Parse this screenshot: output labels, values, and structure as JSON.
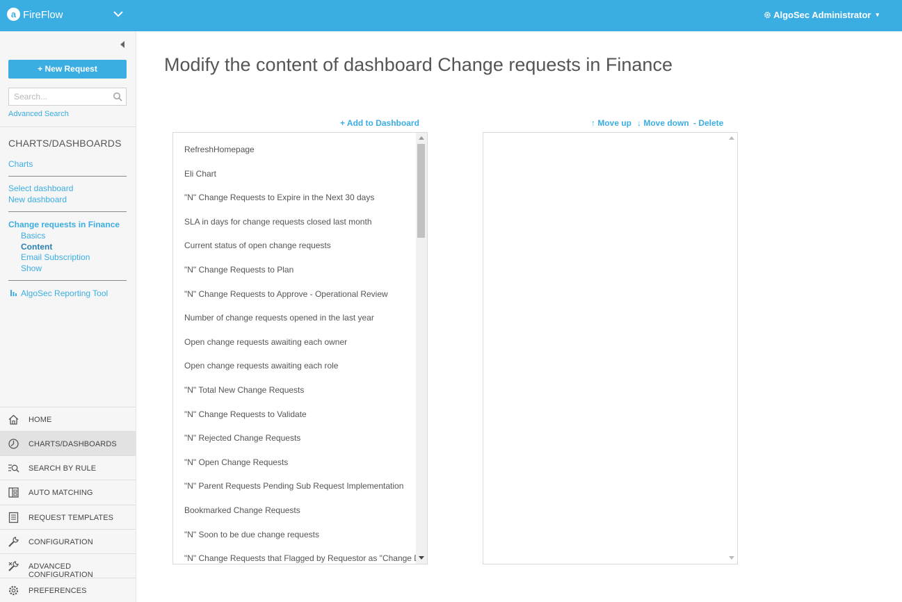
{
  "header": {
    "app_name": "FireFlow",
    "logo_glyph": "a",
    "user_label": "AlgoSec Administrator",
    "user_caret": "▾",
    "user_icon": "gear-icon",
    "accent_color": "#3aade2"
  },
  "sidebar": {
    "new_request_label": "+  New Request",
    "search_placeholder": "Search...",
    "advanced_search_label": "Advanced Search",
    "section_title": "CHARTS/DASHBOARDS",
    "charts_link": "Charts",
    "select_dashboard": "Select dashboard",
    "new_dashboard": "New dashboard",
    "current_dashboard": "Change requests in Finance",
    "sub_links": [
      {
        "label": "Basics"
      },
      {
        "label": "Content",
        "active": true
      },
      {
        "label": "Email Subscription"
      },
      {
        "label": "Show"
      }
    ],
    "reporting_tool": "AlgoSec Reporting Tool"
  },
  "nav": [
    {
      "label": "HOME",
      "icon": "home-icon"
    },
    {
      "label": "CHARTS/DASHBOARDS",
      "icon": "dashboard-icon",
      "active": true
    },
    {
      "label": "SEARCH BY RULE",
      "icon": "search-rule-icon"
    },
    {
      "label": "AUTO MATCHING",
      "icon": "auto-matching-icon"
    },
    {
      "label": "REQUEST TEMPLATES",
      "icon": "templates-icon"
    },
    {
      "label": "CONFIGURATION",
      "icon": "wrench-icon"
    },
    {
      "label": "ADVANCED CONFIGURATION",
      "icon": "advanced-config-icon"
    },
    {
      "label": "PREFERENCES",
      "icon": "preferences-gear-icon"
    }
  ],
  "main": {
    "title": "Modify the content of dashboard Change requests in Finance",
    "add_to_dashboard": "+ Add to Dashboard",
    "move_up": "↑ Move up",
    "move_down": "↓ Move down",
    "delete": "- Delete",
    "available_charts": [
      "RefreshHomepage",
      "Eli Chart",
      "\"N\" Change Requests to Expire in the Next 30 days",
      "SLA in days for change requests closed last month",
      "Current status of open change requests",
      "\"N\" Change Requests to Plan",
      "\"N\" Change Requests to Approve - Operational Review",
      "Number of change requests opened in the last year",
      "Open change requests awaiting each owner",
      "Open change requests awaiting each role",
      "\"N\" Total New Change Requests",
      "\"N\" Change Requests to Validate",
      "\"N\" Rejected Change Requests",
      "\"N\" Open Change Requests",
      "\"N\" Parent Requests Pending Sub Request Implementation",
      "Bookmarked Change Requests",
      "\"N\" Soon to be due change requests",
      "\"N\" Change Requests that Flagged by Requestor as \"Change Does"
    ],
    "dashboard_charts": []
  }
}
